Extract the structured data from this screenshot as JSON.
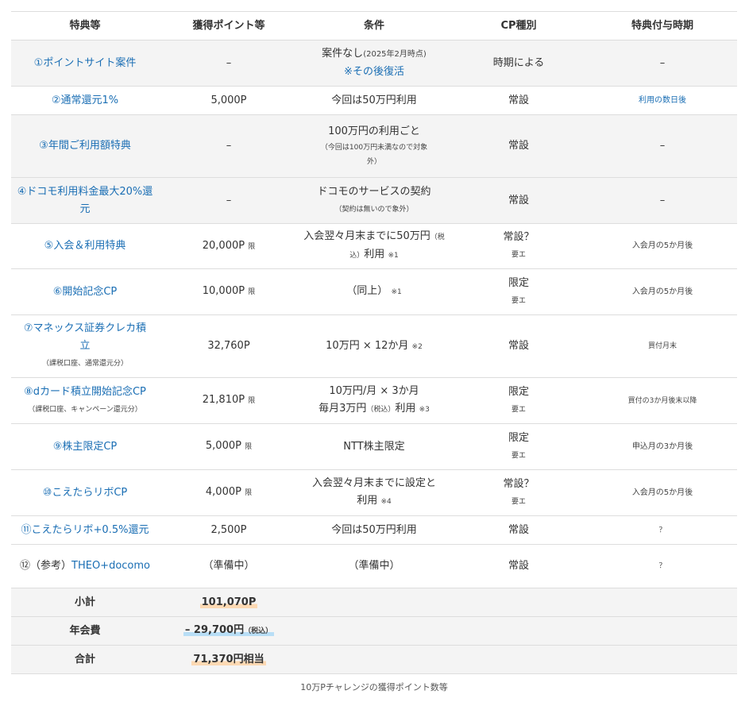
{
  "headers": [
    "特典等",
    "獲得ポイント等",
    "条件",
    "CP種別",
    "特典付与時期"
  ],
  "rows": [
    {
      "c1": "①ポイントサイト案件",
      "c2": "–",
      "c3a": "案件なし",
      "c3b": "(2025年2月時点)",
      "c3c": "※その後復活",
      "c4": "時期による",
      "c5": "–"
    },
    {
      "c1": "②通常還元1%",
      "c2": "5,000P",
      "c3a": "今回は50万円利用",
      "c4": "常設",
      "c5": "利用の数日後"
    },
    {
      "c1": "③年間ご利用額特典",
      "c2": "–",
      "c3a": "100万円の利用ごと",
      "c3b": "（今回は100万円未満なので対象外）",
      "c4": "常設",
      "c5": "–"
    },
    {
      "c1": "④ドコモ利用料金最大20%還元",
      "c2": "–",
      "c3a": "ドコモのサービスの契約",
      "c3b": "（契約は無いので象外）",
      "c4": "常設",
      "c5": "–"
    },
    {
      "c1": "⑤入会＆利用特典",
      "c2": "20,000P",
      "c2s": "限",
      "c3a": "入会翌々月末までに50万円",
      "c3b": "（税込）",
      "c3c": "利用",
      "c3d": "※1",
      "c4": "常設？",
      "c4s": "要エ",
      "c5": "入会月の5か月後"
    },
    {
      "c1": "⑥開始記念CP",
      "c2": "10,000P",
      "c2s": "限",
      "c3a": "（同上）",
      "c3d": "※1",
      "c4": "限定",
      "c4s": "要エ",
      "c5": "入会月の5か月後"
    },
    {
      "c1": "⑦マネックス証券クレカ積立",
      "c1s": "（課税口座、通常還元分）",
      "c2": "32,760P",
      "c3a": "10万円 × 12か月",
      "c3d": "※2",
      "c4": "常設",
      "c5": "買付月末"
    },
    {
      "c1": "⑧dカード積立開始記念CP",
      "c1s": "（課税口座、キャンペーン還元分）",
      "c2": "21,810P",
      "c2s": "限",
      "c3a": "10万円/月 × 3か月",
      "c3b": "毎月3万円",
      "c3c": "（税込）",
      "c3e": "利用",
      "c3d": "※3",
      "c4": "限定",
      "c4s": "要エ",
      "c5": "買付の3か月後末以降"
    },
    {
      "c1": "⑨株主限定CP",
      "c2": "5,000P",
      "c2s": "限",
      "c3a": "NTT株主限定",
      "c4": "限定",
      "c4s": "要エ",
      "c5": "申込月の3か月後"
    },
    {
      "c1": "⑩こえたらリボCP",
      "c2": "4,000P",
      "c2s": "限",
      "c3a": "入会翌々月末までに設定と",
      "c3b": "利用",
      "c3d": "※4",
      "c4": "常設？",
      "c4s": "要エ",
      "c5": "入会月の5か月後"
    },
    {
      "c1": "⑪こえたらリボ+0.5%還元",
      "c2": "2,500P",
      "c3a": "今回は50万円利用",
      "c4": "常設",
      "c5": "？"
    },
    {
      "c1a": "⑫（参考）",
      "c1": "THEO+docomo",
      "c2": "（準備中）",
      "c3a": "（準備中）",
      "c4": "常設",
      "c5": "？"
    }
  ],
  "summary": {
    "subtotal_label": "小計",
    "subtotal_value": "101,070P",
    "fee_label": "年会費",
    "fee_value": "– 29,700円",
    "fee_tax": "（税込）",
    "total_label": "合計",
    "total_value": "71,370円相当"
  },
  "caption": "10万Pチャレンジの獲得ポイント数等",
  "colors": {
    "link": "#1a6eb4",
    "shade": "#f4f4f4",
    "highlight_orange": "#fcd9b3",
    "highlight_blue": "#b8def6",
    "border": "#dddddd"
  }
}
